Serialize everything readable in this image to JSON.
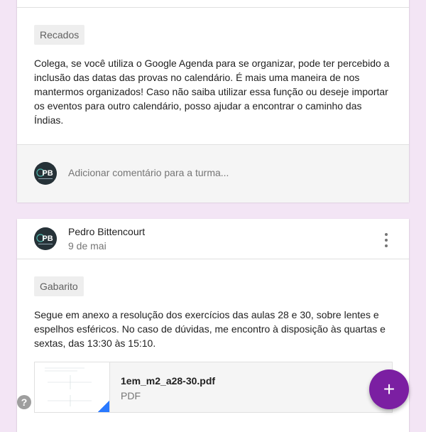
{
  "post1": {
    "tag": "Recados",
    "body": "Colega, se você utiliza o Google Agenda para se organizar, pode ter percebido a inclusão das datas das provas no calendário. É mais uma maneira de nos mantermos organizados! Caso não saiba utilizar essa função ou deseje importar os eventos para outro calendário, posso ajudar a encontrar o caminho das Índias.",
    "comment_placeholder": "Adicionar comentário para a turma..."
  },
  "post2": {
    "author": "Pedro Bittencourt",
    "date": "9 de mai",
    "tag": "Gabarito",
    "body": "Segue em anexo a resolução dos exercícios das aulas 28 e 30, sobre lentes e espelhos esféricos. No caso de dúvidas, me encontro à disposição às quartas e sextas, das 13:30 às 15:10.",
    "attachment": {
      "name": "1em_m2_a28-30.pdf",
      "type": "PDF"
    }
  },
  "avatar": {
    "initials": "PB"
  },
  "help": {
    "icon": "help-circle-icon",
    "glyph": "?"
  },
  "fab": {
    "icon": "plus-icon",
    "glyph": "+"
  },
  "colors": {
    "background": "#f3e5f5",
    "fab": "#7b1fa2",
    "avatar": "#263238",
    "pdf_fold": "#2979ff"
  }
}
